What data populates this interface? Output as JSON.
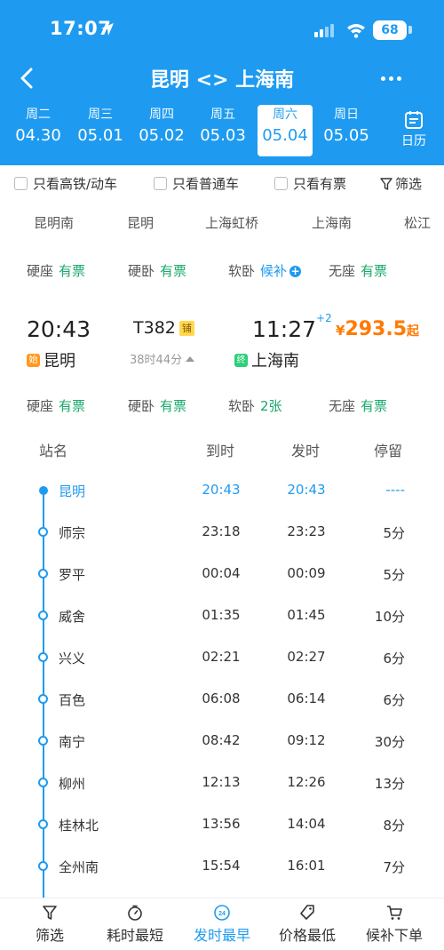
{
  "status_bar": {
    "time": "17:07",
    "battery": "68"
  },
  "nav": {
    "title": "昆明 <> 上海南"
  },
  "dates": [
    {
      "weekday": "周二",
      "date": "04.30",
      "active": false
    },
    {
      "weekday": "周三",
      "date": "05.01",
      "active": false
    },
    {
      "weekday": "周四",
      "date": "05.02",
      "active": false
    },
    {
      "weekday": "周五",
      "date": "05.03",
      "active": false
    },
    {
      "weekday": "周六",
      "date": "05.04",
      "active": true
    },
    {
      "weekday": "周日",
      "date": "05.05",
      "active": false
    }
  ],
  "calendar_label": "日历",
  "filters": {
    "high_speed": "只看高铁/动车",
    "normal": "只看普通车",
    "available": "只看有票",
    "filter": "筛选"
  },
  "stations_strip": [
    "昆明南",
    "昆明",
    "上海虹桥",
    "上海南",
    "松江"
  ],
  "seat_summary": [
    {
      "name": "硬座",
      "status": "有票"
    },
    {
      "name": "硬卧",
      "status": "有票"
    },
    {
      "name": "软卧",
      "status": "候补"
    },
    {
      "name": "无座",
      "status": "有票"
    }
  ],
  "train": {
    "dep_time": "20:43",
    "dep_station": "昆明",
    "start_tag": "始",
    "number": "T382",
    "number_badge": "铺",
    "duration": "38时44分",
    "arr_time": "11:27",
    "arr_day_offset": "+2",
    "arr_station": "上海南",
    "end_tag": "终",
    "price_symbol": "¥",
    "price": "293.5",
    "price_suffix": "起"
  },
  "seat_detail": [
    {
      "name": "硬座",
      "status": "有票"
    },
    {
      "name": "硬卧",
      "status": "有票"
    },
    {
      "name": "软卧",
      "status": "2张"
    },
    {
      "name": "无座",
      "status": "有票"
    }
  ],
  "stops_header": {
    "station": "站名",
    "arrive": "到时",
    "depart": "发时",
    "stay": "停留"
  },
  "stops": [
    {
      "name": "昆明",
      "arrive": "20:43",
      "depart": "20:43",
      "stay": "----"
    },
    {
      "name": "师宗",
      "arrive": "23:18",
      "depart": "23:23",
      "stay": "5分"
    },
    {
      "name": "罗平",
      "arrive": "00:04",
      "depart": "00:09",
      "stay": "5分"
    },
    {
      "name": "威舍",
      "arrive": "01:35",
      "depart": "01:45",
      "stay": "10分"
    },
    {
      "name": "兴义",
      "arrive": "02:21",
      "depart": "02:27",
      "stay": "6分"
    },
    {
      "name": "百色",
      "arrive": "06:08",
      "depart": "06:14",
      "stay": "6分"
    },
    {
      "name": "南宁",
      "arrive": "08:42",
      "depart": "09:12",
      "stay": "30分"
    },
    {
      "name": "柳州",
      "arrive": "12:13",
      "depart": "12:26",
      "stay": "13分"
    },
    {
      "name": "桂林北",
      "arrive": "13:56",
      "depart": "14:04",
      "stay": "8分"
    },
    {
      "name": "全州南",
      "arrive": "15:54",
      "depart": "16:01",
      "stay": "7分"
    }
  ],
  "bottom_tabs": [
    {
      "label": "筛选",
      "icon": "filter-icon",
      "active": false
    },
    {
      "label": "耗时最短",
      "icon": "timer-icon",
      "active": false
    },
    {
      "label": "发时最早",
      "icon": "clock-24-icon",
      "active": true
    },
    {
      "label": "价格最低",
      "icon": "price-tag-icon",
      "active": false
    },
    {
      "label": "候补下单",
      "icon": "cart-icon",
      "active": false
    }
  ],
  "colors": {
    "brand": "#1e9bf0",
    "available": "#1aa86b",
    "price": "#ff7a00"
  }
}
